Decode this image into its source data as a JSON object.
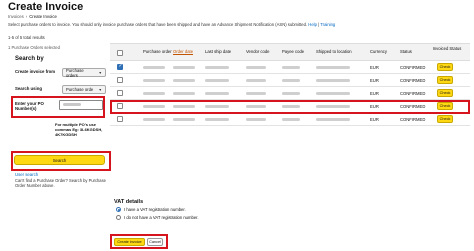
{
  "page": {
    "title": "Create Invoice",
    "breadcrumb": [
      "Invoices",
      "Create Invoice"
    ],
    "info_text": "Select purchase orders to invoice. You should only invoice purchase orders that have been shipped and have an Advance Shipment Notification (ASN) submitted.",
    "help_link": "Help",
    "training_link": "Training",
    "results_text": "1-5 of 5 total results",
    "selected_text": "1 Purchase Orders selected"
  },
  "search": {
    "heading": "Search by",
    "create_from_label": "Create invoice from",
    "create_from_value": "Purchase orders",
    "search_using_label": "Search using",
    "search_using_value": "Purchase orde",
    "po_label": "Enter your PO Number(s)",
    "hint_lines": [
      "For multiple PO's use",
      "commas Eg: 3L6KGDSH,",
      "4K7KGDSH"
    ],
    "search_button": "Search",
    "user_search_link": "User search",
    "cant_find_text": "Can't find a Purchase Order? Search by Purchase Order Number above."
  },
  "table": {
    "columns": [
      "Purchase order",
      "Order date",
      "Last ship date",
      "Vendor code",
      "Payee code",
      "Shipped to location",
      "Currency",
      "Status",
      "Invoiced Status"
    ],
    "sorted_column": "Order date",
    "rows": [
      {
        "checked": true,
        "currency": "EUR",
        "status": "CONFIRMED",
        "action": "Check"
      },
      {
        "checked": false,
        "currency": "EUR",
        "status": "CONFIRMED",
        "action": "Check"
      },
      {
        "checked": false,
        "currency": "EUR",
        "status": "CONFIRMED",
        "action": "Check"
      },
      {
        "checked": false,
        "currency": "EUR",
        "status": "CONFIRMED",
        "action": "Check"
      },
      {
        "checked": false,
        "currency": "EUR",
        "status": "CONFIRMED",
        "action": "Check"
      }
    ]
  },
  "vat": {
    "heading": "VAT details",
    "options": [
      "I have a VAT registration number.",
      "I do not have a VAT registration number."
    ],
    "selected_index": 0
  },
  "actions": {
    "create_label": "Create invoice",
    "cancel_label": "Cancel"
  },
  "colors": {
    "highlight": "#d6141e",
    "button_yellow": "#ffd814",
    "link": "#0066c0",
    "sorted_header": "#c45500"
  }
}
